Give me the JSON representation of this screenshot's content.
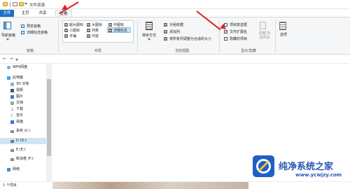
{
  "titlebar": {
    "title": "文件资源"
  },
  "tabs": [
    "文件",
    "主页",
    "共享",
    "查看"
  ],
  "ribbon": {
    "pane_group": {
      "nav_pane": "导航窗格",
      "preview_pane": "预览窗格",
      "details_pane": "详细信息窗格",
      "label": "窗格"
    },
    "layout_group": {
      "items": [
        "超大图标",
        "大图标",
        "中图标",
        "小图标",
        "列表",
        "详细信息",
        "平铺",
        "内容"
      ],
      "selected": "详细信息",
      "label": "布局"
    },
    "view_group": {
      "sort": "排序方式",
      "group_by": "分组依据",
      "add_column": "添加列",
      "fit_columns": "将所有列调整为合适的大小",
      "label": "当前视图"
    },
    "show_group": {
      "item_checkboxes": {
        "label": "项目复选框",
        "checked": false
      },
      "file_extensions": {
        "label": "文件扩展名",
        "checked": true
      },
      "hidden_items": {
        "label": "隐藏的项目",
        "checked": false
      },
      "hide_selected": "隐藏 所选项目",
      "label": "显示/隐藏"
    },
    "options": "选项"
  },
  "nav": {
    "items": [
      {
        "label": "WPS网盘",
        "icon": "cloud-icon"
      },
      {
        "label": "此电脑",
        "icon": "computer-icon"
      },
      {
        "label": "3D 对象",
        "icon": "cube-icon"
      },
      {
        "label": "视频",
        "icon": "video-icon"
      },
      {
        "label": "图片",
        "icon": "picture-icon"
      },
      {
        "label": "文档",
        "icon": "document-icon"
      },
      {
        "label": "下载",
        "icon": "download-icon"
      },
      {
        "label": "音乐",
        "icon": "music-icon"
      },
      {
        "label": "桌面",
        "icon": "desktop-icon"
      },
      {
        "label": "系统 (C:)",
        "icon": "drive-icon"
      },
      {
        "label": "D (D:)",
        "icon": "drive-icon",
        "selected": true
      },
      {
        "label": "E (E:)",
        "icon": "drive-icon"
      },
      {
        "label": "新加卷 (F:)",
        "icon": "drive-icon"
      },
      {
        "label": "网络",
        "icon": "network-icon"
      }
    ]
  },
  "status": {
    "text": "1 个项目"
  },
  "watermark": {
    "title": "纯净系统之家",
    "url": "www.ycwjzy.com"
  }
}
